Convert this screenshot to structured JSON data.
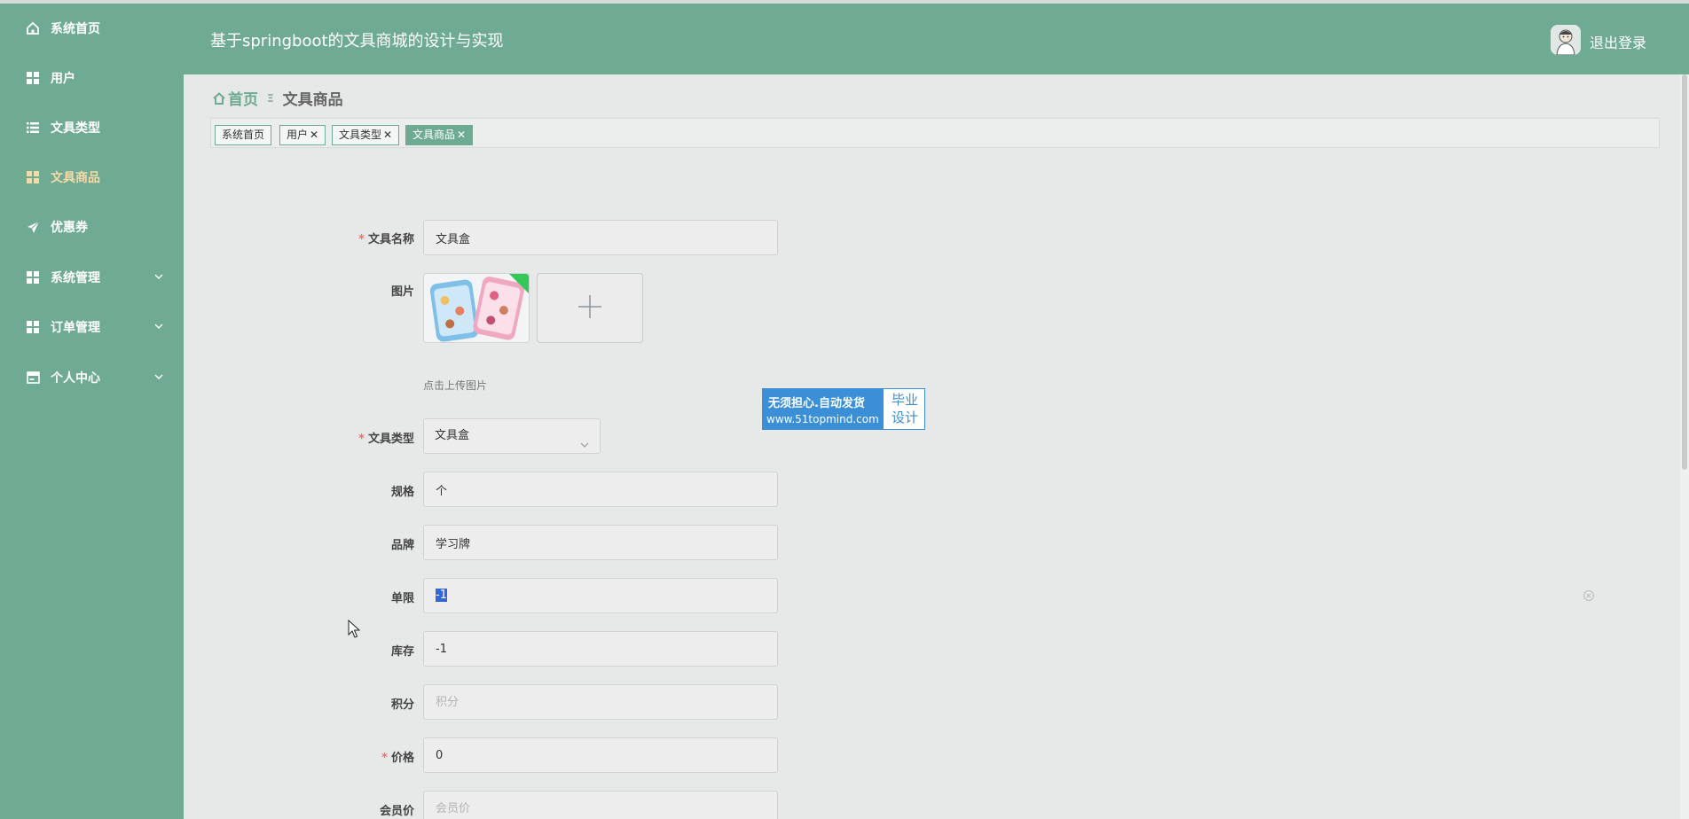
{
  "sidebar": {
    "items": [
      {
        "label": "系统首页",
        "icon": "home-icon"
      },
      {
        "label": "用户",
        "icon": "grid-icon"
      },
      {
        "label": "文具类型",
        "icon": "list-icon"
      },
      {
        "label": "文具商品",
        "icon": "grid-icon",
        "active": true
      },
      {
        "label": "优惠券",
        "icon": "send-icon"
      },
      {
        "label": "系统管理",
        "icon": "grid-icon",
        "expandable": true
      },
      {
        "label": "订单管理",
        "icon": "grid-icon",
        "expandable": true
      },
      {
        "label": "个人中心",
        "icon": "card-icon",
        "expandable": true
      }
    ]
  },
  "header": {
    "title": "基于springboot的文具商城的设计与实现",
    "logout": "退出登录"
  },
  "breadcrumb": {
    "home": "首页",
    "separator": "Ξ",
    "current": "文具商品"
  },
  "tags": [
    {
      "label": "系统首页",
      "closable": false
    },
    {
      "label": "用户",
      "closable": true
    },
    {
      "label": "文具类型",
      "closable": true
    },
    {
      "label": "文具商品",
      "closable": true,
      "active": true
    }
  ],
  "tag_close_glyph": "✕",
  "form": {
    "name": {
      "label": "文具名称",
      "value": "文具盒",
      "required": true
    },
    "image": {
      "label": "图片",
      "tip": "点击上传图片"
    },
    "type": {
      "label": "文具类型",
      "value": "文具盒",
      "required": true
    },
    "spec": {
      "label": "规格",
      "value": "个"
    },
    "brand": {
      "label": "品牌",
      "value": "学习牌"
    },
    "limit": {
      "label": "单限",
      "value": "-1"
    },
    "stock": {
      "label": "库存",
      "value": "-1"
    },
    "points": {
      "label": "积分",
      "placeholder": "积分"
    },
    "price": {
      "label": "价格",
      "value": "0",
      "required": true
    },
    "member_price": {
      "label": "会员价",
      "placeholder": "会员价"
    }
  },
  "required_mark": "*",
  "watermark": {
    "line1": "无须担心.自动发货",
    "line2": "www.51topmind.com",
    "right": "毕业设计"
  },
  "colors": {
    "primary": "#6fab93",
    "active_menu": "#f6d9a6",
    "required": "#f56c6c",
    "watermark": "#3a8fd6"
  }
}
